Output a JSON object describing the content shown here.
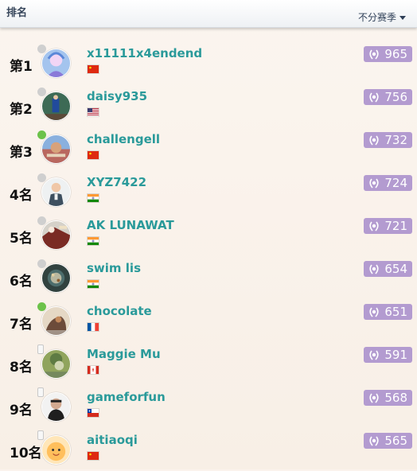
{
  "header": {
    "title": "排名",
    "season_label": "不分赛季"
  },
  "colors": {
    "player_name": "#2a9a9a",
    "score_badge": "#b39bd0",
    "online": "#6cc24a",
    "offline": "#cfcfcf"
  },
  "icons": {
    "score": "laurel-wreath-icon",
    "dropdown": "chevron-down-icon"
  },
  "players": [
    {
      "rank": "第1",
      "name": "x11111x4endend",
      "score": "965",
      "flag": "china",
      "status": "offline"
    },
    {
      "rank": "第2",
      "name": "daisy935",
      "score": "756",
      "flag": "usa",
      "status": "offline"
    },
    {
      "rank": "第3",
      "name": "challengell",
      "score": "732",
      "flag": "china",
      "status": "online"
    },
    {
      "rank": "4名",
      "name": "XYZ7422",
      "score": "724",
      "flag": "india",
      "status": "offline"
    },
    {
      "rank": "5名",
      "name": "AK LUNAWAT",
      "score": "721",
      "flag": "india",
      "status": "offline"
    },
    {
      "rank": "6名",
      "name": "swim lis",
      "score": "654",
      "flag": "india",
      "status": "offline"
    },
    {
      "rank": "7名",
      "name": "chocolate",
      "score": "651",
      "flag": "france",
      "status": "online"
    },
    {
      "rank": "8名",
      "name": "Maggie Mu",
      "score": "591",
      "flag": "canada",
      "status": "mobile"
    },
    {
      "rank": "9名",
      "name": "gameforfun",
      "score": "568",
      "flag": "chile",
      "status": "mobile"
    },
    {
      "rank": "10名",
      "name": "aitiaoqi",
      "score": "565",
      "flag": "china",
      "status": "mobile"
    }
  ]
}
